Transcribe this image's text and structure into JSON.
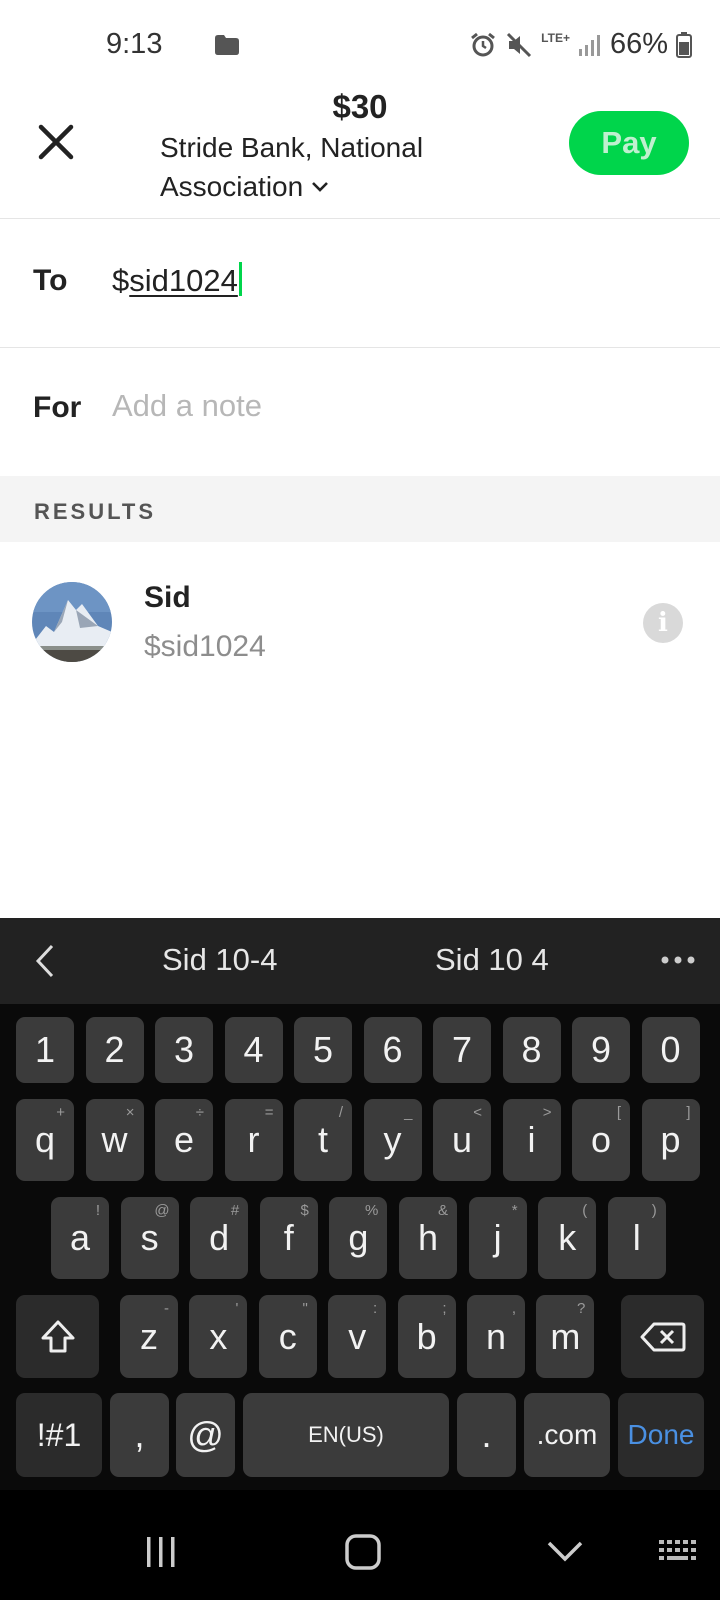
{
  "status_bar": {
    "time": "9:13",
    "network": "LTE+",
    "battery": "66%"
  },
  "header": {
    "amount": "$30",
    "bank_line1": "Stride Bank, National",
    "bank_line2": "Association",
    "pay_label": "Pay",
    "pay_color": "#00d54b"
  },
  "form": {
    "to_label": "To",
    "to_prefix": "$",
    "to_value": "sid1024",
    "for_label": "For",
    "for_placeholder": "Add a note"
  },
  "results": {
    "section_label": "RESULTS",
    "items": [
      {
        "name": "Sid",
        "handle": "$sid1024"
      }
    ]
  },
  "keyboard": {
    "suggestions": [
      "Sid 10-4",
      "Sid 10 4"
    ],
    "numbers": [
      "1",
      "2",
      "3",
      "4",
      "5",
      "6",
      "7",
      "8",
      "9",
      "0"
    ],
    "row1": [
      {
        "k": "q",
        "h": "+"
      },
      {
        "k": "w",
        "h": "×"
      },
      {
        "k": "e",
        "h": "÷"
      },
      {
        "k": "r",
        "h": "="
      },
      {
        "k": "t",
        "h": "/"
      },
      {
        "k": "y",
        "h": "_"
      },
      {
        "k": "u",
        "h": "<"
      },
      {
        "k": "i",
        "h": ">"
      },
      {
        "k": "o",
        "h": "["
      },
      {
        "k": "p",
        "h": "]"
      }
    ],
    "row2": [
      {
        "k": "a",
        "h": "!"
      },
      {
        "k": "s",
        "h": "@"
      },
      {
        "k": "d",
        "h": "#"
      },
      {
        "k": "f",
        "h": "$"
      },
      {
        "k": "g",
        "h": "%"
      },
      {
        "k": "h",
        "h": "&"
      },
      {
        "k": "j",
        "h": "*"
      },
      {
        "k": "k",
        "h": "("
      },
      {
        "k": "l",
        "h": ")"
      }
    ],
    "row3": [
      {
        "k": "z",
        "h": "-"
      },
      {
        "k": "x",
        "h": "'"
      },
      {
        "k": "c",
        "h": "\""
      },
      {
        "k": "v",
        "h": ":"
      },
      {
        "k": "b",
        "h": ";"
      },
      {
        "k": "n",
        "h": ","
      },
      {
        "k": "m",
        "h": "?"
      }
    ],
    "sym_label": "!#1",
    "comma_label": ",",
    "at_label": "@",
    "space_label": "EN(US)",
    "period_label": ".",
    "com_label": ".com",
    "done_label": "Done"
  }
}
